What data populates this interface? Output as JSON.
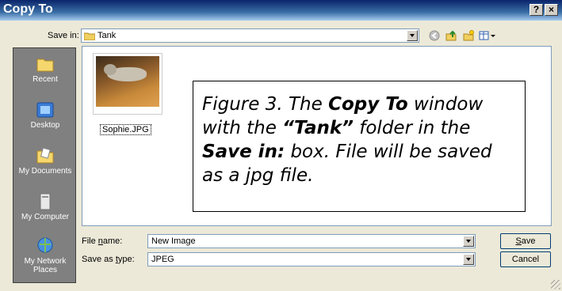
{
  "window": {
    "title": "Copy To",
    "help_label": "?",
    "close_label": "×"
  },
  "save_in": {
    "label": "Save in:",
    "value": "Tank"
  },
  "toolbar": {
    "icons": [
      "back-icon",
      "up-folder-icon",
      "new-folder-icon",
      "views-icon"
    ]
  },
  "places": [
    {
      "label": "Recent",
      "icon": "recent-folder-icon"
    },
    {
      "label": "Desktop",
      "icon": "desktop-icon"
    },
    {
      "label": "My Documents",
      "icon": "my-documents-icon"
    },
    {
      "label": "My Computer",
      "icon": "my-computer-icon"
    },
    {
      "label": "My Network Places",
      "icon": "network-places-icon"
    }
  ],
  "files": [
    {
      "name": "Sophie.JPG"
    }
  ],
  "callout": {
    "line1_a": "Figure 3.  The ",
    "line1_b": "Copy To",
    "line1_c": " window",
    "line2_a": "with the ",
    "line2_b": "“Tank”",
    "line2_c": " folder in the",
    "line3_a": "Save in:",
    "line3_b": " box.  File will be saved",
    "line4": "as a jpg file."
  },
  "file_name": {
    "label_pre": "File ",
    "label_u": "n",
    "label_post": "ame:",
    "value": "New Image"
  },
  "save_as_type": {
    "label_pre": "Save as ",
    "label_u": "t",
    "label_post": "ype:",
    "value": "JPEG"
  },
  "buttons": {
    "save_u": "S",
    "save_rest": "ave",
    "cancel": "Cancel"
  }
}
